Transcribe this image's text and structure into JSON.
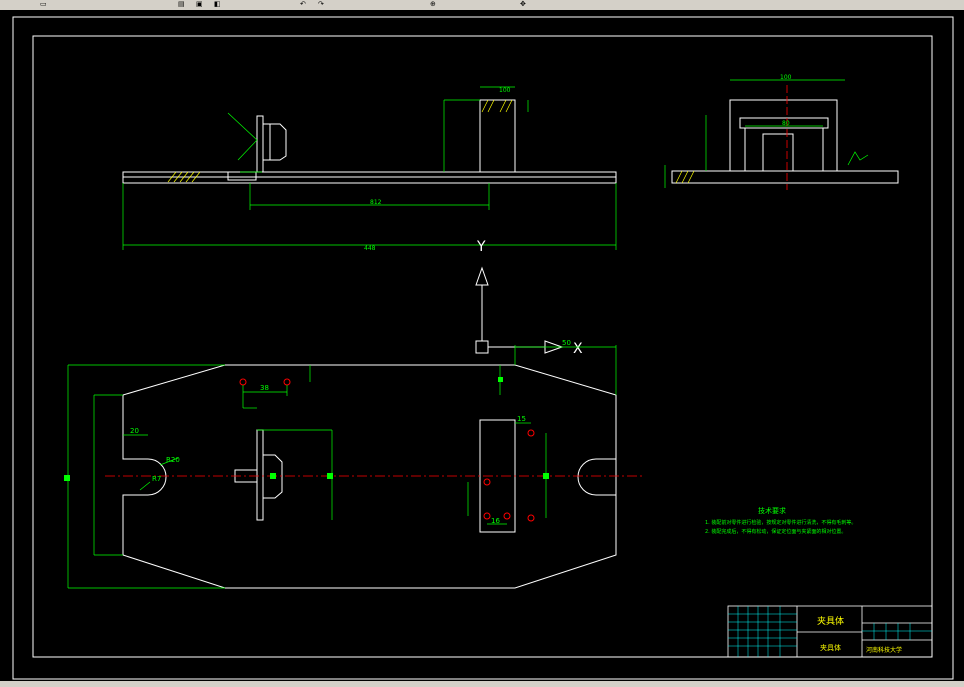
{
  "colors": {
    "background": "#000000",
    "outline": "#ffffff",
    "dimension": "#00ff00",
    "centerline": "#ff0000",
    "hatch": "#ffff00",
    "toolbar": "#d4d0c8"
  },
  "toolbar": {
    "icons": [
      "file-icon",
      "open-icon",
      "save-icon",
      "print-icon",
      "undo-icon",
      "redo-icon",
      "zoom-icon",
      "pan-icon"
    ]
  },
  "dims": {
    "d100_top": "100",
    "d812": "812",
    "d448": "448",
    "d100_side": "100",
    "d80": "80",
    "d50": "50",
    "d38": "38",
    "d20": "20",
    "d15": "15",
    "r20": "R20",
    "r7": "R7",
    "d16": "16"
  },
  "axes": {
    "y_label": "Y",
    "x_label": "X"
  },
  "notes": {
    "title": "技术要求",
    "line1": "1. 装配前对零件进行检验，按规定对零件进行清洗，不得有毛刺等。",
    "line2": "2. 装配完成后，不得有松动，保证定位面与夹紧面的相对位置。"
  },
  "title_block": {
    "drawing_name": "夹具体",
    "part_name": "夹具体",
    "school": "河南科技大学"
  }
}
